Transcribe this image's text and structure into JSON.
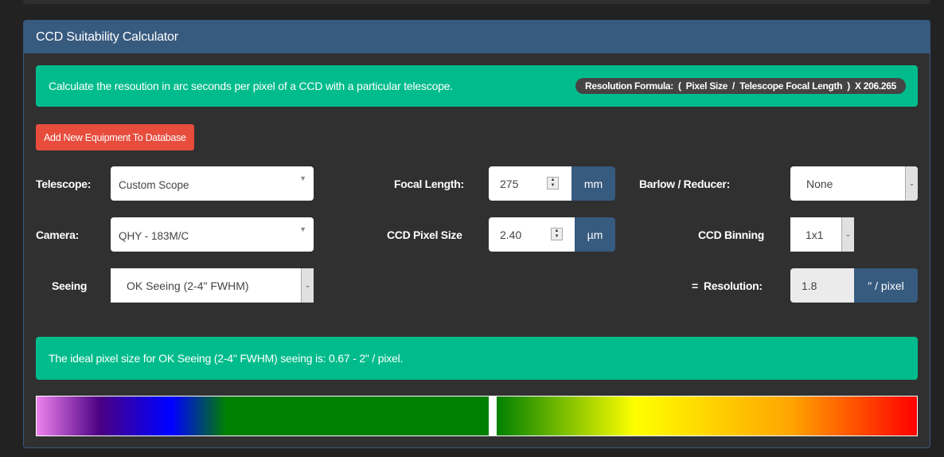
{
  "panel": {
    "title": "CCD Suitability Calculator"
  },
  "intro_alert": {
    "text": "Calculate the resoution in arc seconds per pixel of a CCD with a particular telescope.",
    "formula": {
      "label": "Resolution Formula:",
      "open_paren": "(",
      "term1": "Pixel Size",
      "divider": "/",
      "term2": "Telescope Focal Length",
      "close_paren": ")",
      "multiplier": "X 206.265"
    }
  },
  "add_equipment_button": "Add New Equipment To Database",
  "form": {
    "telescope": {
      "label": "Telescope:",
      "value": "Custom Scope"
    },
    "camera": {
      "label": "Camera:",
      "value": "QHY - 183M/C"
    },
    "seeing": {
      "label": "Seeing",
      "value": "OK Seeing (2-4\" FWHM)"
    },
    "focal_length": {
      "label": "Focal Length:",
      "value": "275",
      "unit": "mm"
    },
    "pixel_size": {
      "label": "CCD Pixel Size",
      "value": "2.40",
      "unit": "µm"
    },
    "barlow": {
      "label": "Barlow / Reducer:",
      "value": "None"
    },
    "binning": {
      "label": "CCD Binning",
      "value": "1x1"
    },
    "resolution": {
      "label": "=  Resolution:",
      "value": "1.8",
      "unit": "\" / pixel"
    }
  },
  "result_alert": {
    "text": "The ideal pixel size for OK Seeing (2-4\" FWHM) seeing is: 0.67 - 2\" / pixel."
  },
  "spectrum": {
    "marker_value": 1.8,
    "colors": {
      "violet": "#ee82ee",
      "indigo": "#4b0082",
      "blue": "#0000ff",
      "green": "#008000",
      "yellow": "#ffff00",
      "orange": "#ffa500",
      "red": "#ff0000"
    }
  },
  "colors": {
    "primary": "#375a7f",
    "success": "#00bc8c",
    "danger": "#e74c3c",
    "background": "#222222",
    "panel_body": "#303030"
  },
  "icons": {
    "select_caret": "▼",
    "dropdown_chevron": "⌄",
    "spin_up": "▲",
    "spin_down": "▼"
  }
}
